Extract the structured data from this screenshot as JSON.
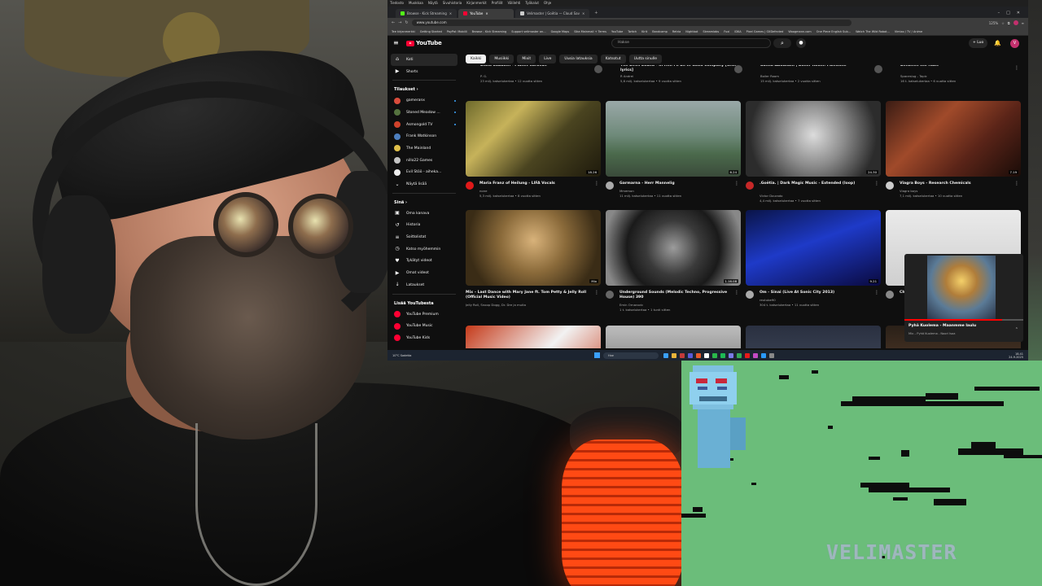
{
  "browser": {
    "menu": [
      "Tiedosto",
      "Muokkaa",
      "Näytä",
      "Sivuhistoria",
      "Kirjanmerkit",
      "Profiilit",
      "Välilehti",
      "Työkalut",
      "Ohje"
    ],
    "tabs": [
      {
        "label": "Browse - Kick Streaming",
        "color": "#53fc18",
        "active": false
      },
      {
        "label": "YouTube",
        "color": "#ff0033",
        "active": true
      },
      {
        "label": "Velimaster | Goëtia — Cloud Sav",
        "color": "#cccccc",
        "active": false
      }
    ],
    "url": "www.youtube.com",
    "zoom": "125%",
    "bookmarks": [
      "Tee kirjanmerkki",
      "Getting Started",
      "PayPal: Mobiili",
      "Browse - Kick Streaming",
      "Support velimaster on...",
      "Google Maps",
      "Sika Mainmail + Terms",
      "YouTube",
      "Twitch",
      "Kirit",
      "Bandcamp",
      "Retria",
      "Nightbot",
      "Streamlabs",
      "Fuxi",
      "IDKA",
      "Pixel Games | OXDefected",
      "Woogmann.com",
      "One Piece English Sub...",
      "Watch The Wild Robot...",
      "Vimixo / TV / Anime"
    ]
  },
  "youtube": {
    "logo": "YouTube",
    "search_placeholder": "Hakse",
    "create_label": "+ Luo",
    "avatar_letter": "V",
    "chips": [
      {
        "label": "Kaikki",
        "active": true
      },
      {
        "label": "Musiikki",
        "active": false
      },
      {
        "label": "Mixit",
        "active": false
      },
      {
        "label": "Live",
        "active": false
      },
      {
        "label": "Uusia latauksia",
        "active": false
      },
      {
        "label": "Katsotut",
        "active": false
      },
      {
        "label": "Uutta sinulle",
        "active": false
      }
    ],
    "sidebar": {
      "main": [
        {
          "label": "Koti",
          "icon": "home-icon",
          "glyph": "⌂",
          "active": true
        },
        {
          "label": "Shorts",
          "icon": "shorts-icon",
          "glyph": "▶",
          "active": false
        }
      ],
      "subs_header": "Tilaukset ›",
      "subs": [
        {
          "label": "gameranx",
          "color": "#d94c3c",
          "dot": true
        },
        {
          "label": "Stoned Meadow ...",
          "color": "#55733f",
          "dot": true
        },
        {
          "label": "Asmongold TV",
          "color": "#d0422b",
          "dot": true
        },
        {
          "label": "Frank Watkinson",
          "color": "#4d7fbf",
          "dot": false
        },
        {
          "label": "The Mainland",
          "color": "#e0c04a",
          "dot": false
        },
        {
          "label": "nillo22 Games",
          "color": "#c4c4c4",
          "dot": false
        },
        {
          "label": "Evil Stöö - aiheka...",
          "color": "#eeeeee",
          "dot": false
        },
        {
          "label": "Näytä lisää",
          "color": "",
          "dot": false
        }
      ],
      "you_header": "Sinä ›",
      "you": [
        {
          "label": "Oma kanava",
          "glyph": "▣",
          "icon": "channel-icon"
        },
        {
          "label": "Historia",
          "glyph": "↺",
          "icon": "history-icon"
        },
        {
          "label": "Soittolistat",
          "glyph": "≡",
          "icon": "playlists-icon"
        },
        {
          "label": "Katso myöhemmin",
          "glyph": "◷",
          "icon": "watch-later-icon"
        },
        {
          "label": "Tykätyt videot",
          "glyph": "♥",
          "icon": "like-icon"
        },
        {
          "label": "Omat videot",
          "glyph": "▶",
          "icon": "my-videos-icon"
        },
        {
          "label": "Lataukset",
          "glyph": "↓",
          "icon": "download-icon"
        }
      ],
      "more_header": "Lisää YouTubesta",
      "more": [
        {
          "label": "YouTube Premium",
          "color": "#ff0033"
        },
        {
          "label": "YouTube Music",
          "color": "#ff0033"
        },
        {
          "label": "YouTube Kids",
          "color": "#ff0033"
        }
      ]
    },
    "prev_row": [
      {
        "title": "Black Sabbath - Planet Caravan",
        "channel": "P. G.",
        "stats": "23 milj. katselukertaa • 12 vuotta sitten"
      },
      {
        "title": "The Devil Sound - In Hell I'll Be In Good Company [with lyrics]",
        "channel": "R Andrei",
        "stats": "5,6 milj. katselukertaa • 9 vuotta sitten"
      },
      {
        "title": "Samia Abdullahi | Boiler Room: Palestine",
        "channel": "Boiler Room",
        "stats": "15 milj. katselukertaa • 2 vuotta sitten"
      },
      {
        "title": "Between the Haze",
        "channel": "Spaceslug - Topic",
        "stats": "16 t. katselukertaa • 6 vuotta sitten"
      }
    ],
    "row1": [
      {
        "title": "Maria Franz of Heilung - LIFA Vocals",
        "channel": "none",
        "stats": "5,3 milj. katselukertaa • 8 vuotta sitten",
        "duration": "18.26",
        "thumb": "linear-gradient(135deg,#6e6a2c 0%,#c6b25a 30%,#4a4420 60%,#1e1a0c 100%)",
        "avatar": "#e01919"
      },
      {
        "title": "Garmarna - Herr Mannelig",
        "channel": "Mmemon",
        "stats": "11 milj. katselukertaa • 11 vuotta sitten",
        "duration": "6.24",
        "thumb": "linear-gradient(180deg,#9aa8a8 0%,#6f8a7a 45%,#4b6a4c 70%,#3a4a3a 100%)",
        "avatar": "#aaaaaa"
      },
      {
        "title": ".Goëtia. | Dark Magic Music - Extended (loop)",
        "channel": "Victor Dourado",
        "stats": "4,4 milj. katselukertaa • 7 vuotta sitten",
        "duration": "24.30",
        "thumb": "radial-gradient(circle at 50% 45%,#dcdcdc 0%,#8a8a8a 40%,#2c2c2c 80%)",
        "avatar": "#c62828"
      },
      {
        "title": "Viagra Boys - Research Chemicals",
        "channel": "Viagra boys",
        "stats": "7,1 milj. katselukertaa • 10 vuotta sitten",
        "duration": "7.19",
        "thumb": "linear-gradient(135deg,#3a1c14 0%,#a04a2a 35%,#5a2418 65%,#1a0c08 100%)",
        "avatar": "#cccccc"
      }
    ],
    "row2": [
      {
        "title": "Mix – Last Dance with Mary Jane ft. Tom Petty & Jelly Roll (Official Music Video)",
        "channel": "Jelly Roll, Snoop Dogg, Dr. Dre ja muita",
        "stats": "",
        "duration": "Mix",
        "thumb": "radial-gradient(circle at 50% 40%,#d8b27a 0%,#8a6a3a 40%,#3a2c16 80%)",
        "avatar": ""
      },
      {
        "title": "Underground Sounds (Melodic Techno, Progressive House) 390",
        "channel": "Emin Ornarovic",
        "stats": "1 t. katselukertaa • 1 tunti sitten",
        "duration": "1.16.08",
        "thumb": "radial-gradient(circle at 50% 50%,#9c9c9c 0%,#3a3a3a 35%,#1a1a1a 60%,#888 90%)",
        "avatar": "#666666"
      },
      {
        "title": "Om - Sinai (Live At Sonic City 2013)",
        "channel": "reutube90",
        "stats": "304 t. katselukertaa • 11 vuotta sitten",
        "duration": "9.21",
        "thumb": "linear-gradient(160deg,#0a1448 0%,#1e3ac8 45%,#0a0a40 100%)",
        "avatar": "#aaaaaa"
      },
      {
        "title": "Chelsea Wolfe",
        "channel": "",
        "stats": "",
        "duration": "",
        "thumb": "linear-gradient(180deg,#eaeaea 0%,#cfcfcf 100%)",
        "avatar": "#888888"
      }
    ],
    "row3_thumbs": [
      "linear-gradient(135deg,#c53a1a 0%,#f2f2f2 50%,#c53a1a 100%)",
      "linear-gradient(180deg,#bdbdbd 0%,#5a5a5a 100%)",
      "linear-gradient(180deg,#2a3040 0%,#4a5468 100%)",
      "linear-gradient(180deg,#2a2018 0%,#6a4a32 100%)"
    ],
    "miniplayer": {
      "title": "Pyhä Kuolema - Maanmme laulu",
      "subtitle": "Mix – Pyhä Kuolema - Noori Isoa"
    }
  },
  "taskbar": {
    "weather": "10°C Sadetta",
    "search": "Hae",
    "time": "18.41",
    "date": "24.9.2025",
    "apps": [
      "#3aa0ff",
      "#e8b33a",
      "#c33a3a",
      "#5a5ad8",
      "#e85a2a",
      "#ffffff",
      "#2ab84a",
      "#1db954",
      "#7a7ae8",
      "#33aa55",
      "#e81a1a",
      "#c44ac4",
      "#2a9aff",
      "#888888"
    ]
  },
  "overlay": {
    "brand": "VELIMASTER"
  }
}
